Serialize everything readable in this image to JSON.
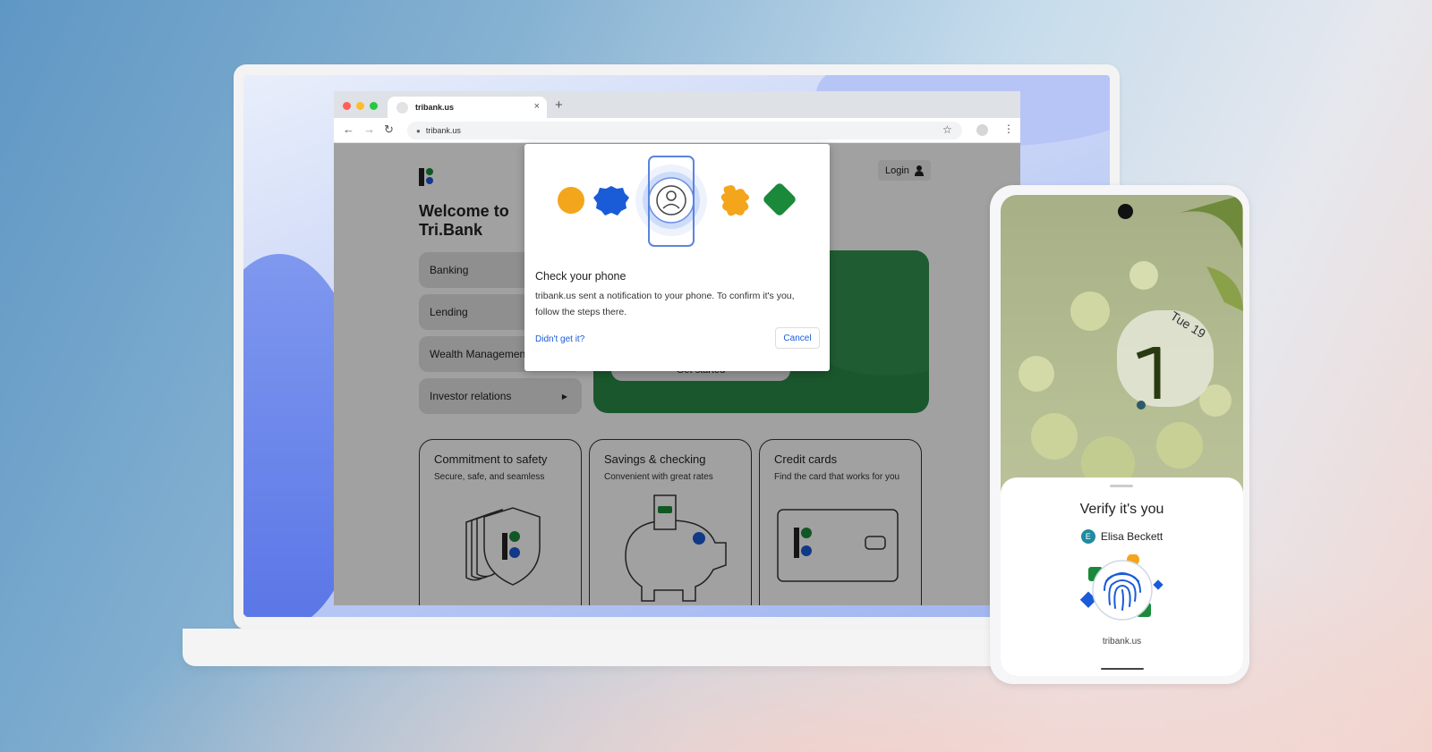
{
  "browser": {
    "tab_title": "tribank.us",
    "tab_close": "×",
    "new_tab": "+",
    "url": "tribank.us",
    "nav": {
      "back": "←",
      "forward": "→",
      "reload": "↻",
      "star": "☆",
      "menu": "⋮"
    }
  },
  "site": {
    "welcome": "Welcome to Tri.Bank",
    "login_label": "Login",
    "menu": [
      {
        "label": "Banking"
      },
      {
        "label": "Lending"
      },
      {
        "label": "Wealth Management"
      },
      {
        "label": "Investor relations"
      }
    ],
    "hero_button": "Get started",
    "cards": [
      {
        "title": "Commitment to safety",
        "subtitle": "Secure, safe, and seamless"
      },
      {
        "title": "Savings & checking",
        "subtitle": "Convenient with great rates"
      },
      {
        "title": "Credit cards",
        "subtitle": "Find the card that works for you"
      }
    ]
  },
  "dialog": {
    "title": "Check your phone",
    "body": "tribank.us sent a notification to your phone. To confirm it's you, follow the steps there.",
    "help_link": "Didn't get it?",
    "cancel": "Cancel"
  },
  "phone": {
    "date": "Tue 19",
    "verify_title": "Verify it's you",
    "user_initial": "E",
    "user_name": "Elisa Beckett",
    "site": "tribank.us"
  },
  "colors": {
    "brand_green": "#1a8a3a",
    "brand_blue": "#1a5bd8",
    "accent_yellow": "#f3a51b",
    "hero_green": "#2c8a48",
    "link_blue": "#1a5bd8"
  }
}
